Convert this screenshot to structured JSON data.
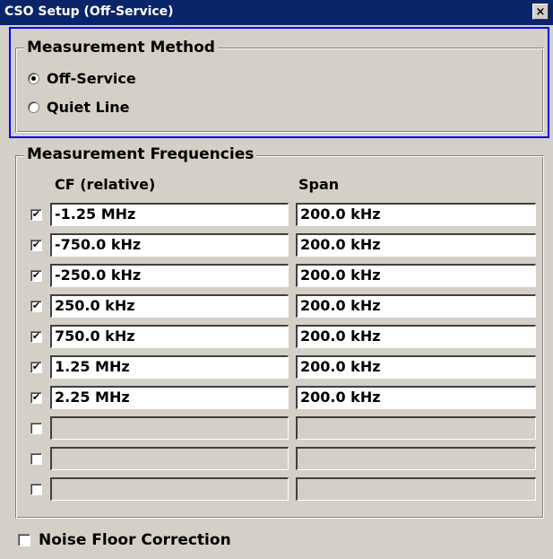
{
  "window": {
    "title": "CSO Setup (Off-Service)",
    "close_glyph": "×"
  },
  "measurement_method": {
    "legend": "Measurement Method",
    "options": [
      {
        "label": "Off-Service",
        "checked": true
      },
      {
        "label": "Quiet Line",
        "checked": false
      }
    ]
  },
  "measurement_frequencies": {
    "legend": "Measurement Frequencies",
    "col_cf": "CF (relative)",
    "col_span": "Span",
    "rows": [
      {
        "checked": true,
        "cf": "-1.25 MHz",
        "span": "200.0 kHz"
      },
      {
        "checked": true,
        "cf": "-750.0 kHz",
        "span": "200.0 kHz"
      },
      {
        "checked": true,
        "cf": "-250.0 kHz",
        "span": "200.0 kHz"
      },
      {
        "checked": true,
        "cf": "250.0 kHz",
        "span": "200.0 kHz"
      },
      {
        "checked": true,
        "cf": "750.0 kHz",
        "span": "200.0 kHz"
      },
      {
        "checked": true,
        "cf": "1.25 MHz",
        "span": "200.0 kHz"
      },
      {
        "checked": true,
        "cf": "2.25 MHz",
        "span": "200.0 kHz"
      },
      {
        "checked": false,
        "cf": "",
        "span": ""
      },
      {
        "checked": false,
        "cf": "",
        "span": ""
      },
      {
        "checked": false,
        "cf": "",
        "span": ""
      }
    ]
  },
  "noise_floor": {
    "label": "Noise Floor Correction",
    "checked": false
  },
  "colors": {
    "title_bar": "#0a246a",
    "dialog_bg": "#d4d0c8",
    "focus_frame": "#0000ff"
  }
}
